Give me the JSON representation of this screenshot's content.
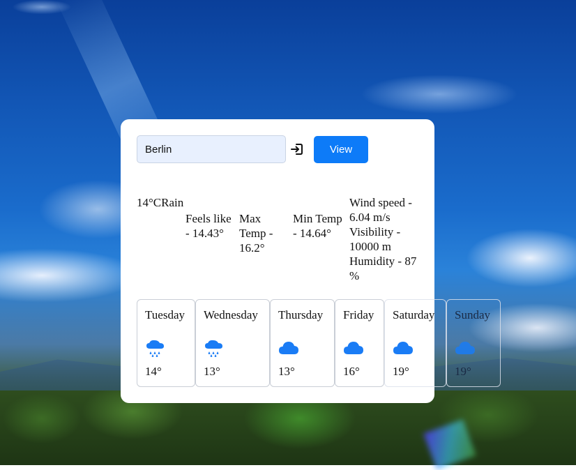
{
  "search": {
    "value": "Berlin",
    "view_label": "View"
  },
  "current": {
    "temp_condition": "14°CRain",
    "feels_like": "Feels like - 14.43°",
    "max_temp": "Max Temp - 16.2°",
    "min_temp": "Min Temp - 14.64°",
    "wind": "Wind speed - 6.04 m/s",
    "visibility": "Visibility - 10000 m",
    "humidity": "Humidity - 87 %"
  },
  "forecast": [
    {
      "day": "Tuesday",
      "temp": "14°",
      "icon": "rain-cloud-icon"
    },
    {
      "day": "Wednesday",
      "temp": "13°",
      "icon": "rain-cloud-icon"
    },
    {
      "day": "Thursday",
      "temp": "13°",
      "icon": "cloud-icon"
    },
    {
      "day": "Friday",
      "temp": "16°",
      "icon": "cloud-icon"
    },
    {
      "day": "Saturday",
      "temp": "19°",
      "icon": "cloud-icon"
    },
    {
      "day": "Sunday",
      "temp": "19°",
      "icon": "cloud-icon"
    }
  ],
  "colors": {
    "accent": "#0d7bf8",
    "input_bg": "#e8f0fe"
  }
}
